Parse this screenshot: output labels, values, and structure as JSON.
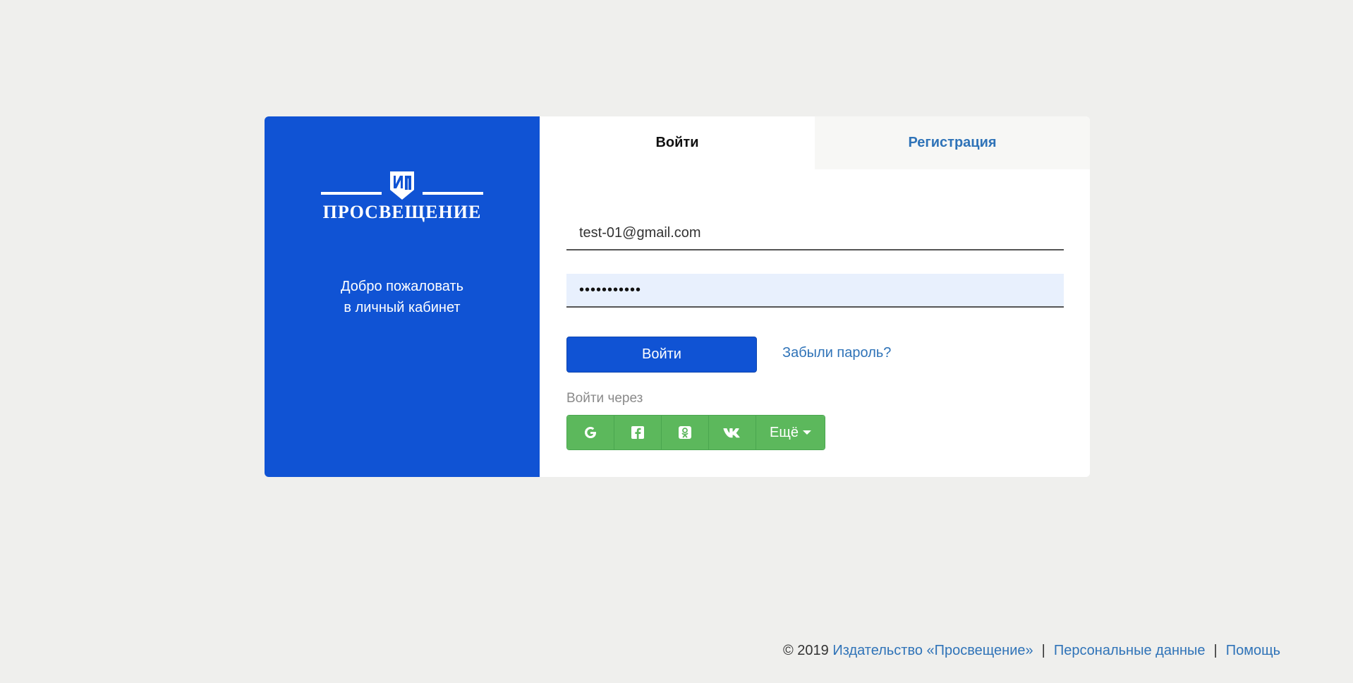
{
  "brand": {
    "logo_text": "ПРОСВЕЩЕНИЕ",
    "welcome_line1": "Добро пожаловать",
    "welcome_line2": "в личный кабинет",
    "color": "#1053d4"
  },
  "tabs": [
    {
      "label": "Войти",
      "active": true
    },
    {
      "label": "Регистрация",
      "active": false
    }
  ],
  "form": {
    "email_value": "test-01@gmail.com",
    "password_value": "•••••••••••",
    "login_button": "Войти",
    "forgot_link": "Забыли пароль?",
    "social_label": "Войти через",
    "social": [
      {
        "icon": "google-icon"
      },
      {
        "icon": "facebook-icon"
      },
      {
        "icon": "odnoklassniki-icon"
      },
      {
        "icon": "vk-icon"
      }
    ],
    "more_label": "Ещё",
    "social_color": "#5cb85c"
  },
  "footer": {
    "copyright": "© 2019",
    "publisher_link": "Издательство «Просвещение»",
    "separator": "|",
    "personal_data_link": "Персональные данные",
    "help_link": "Помощь"
  }
}
